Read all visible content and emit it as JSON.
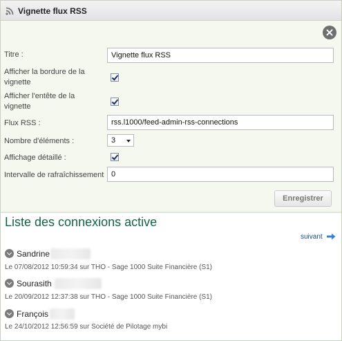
{
  "widget": {
    "title": "Vignette flux RSS",
    "icons": {
      "header": "rss-icon",
      "close": "close-circle-icon"
    }
  },
  "form": {
    "title_label": "Titre :",
    "title_value": "Vignette flux RSS",
    "border_label_1": "Afficher la bordure de la",
    "border_label_2": "vignette",
    "border_checked": true,
    "header_label_1": "Afficher l'entête de la",
    "header_label_2": "vignette",
    "header_checked": true,
    "feed_label": "Flux RSS :",
    "feed_value": "rss.l1000/feed-admin-rss-connections",
    "count_label": "Nombre d'éléments :",
    "count_value": "3",
    "detailed_label": "Affichage détaillé :",
    "detailed_checked": true,
    "refresh_label": "Intervalle de rafraîchissement",
    "refresh_value": "0",
    "save_label": "Enregistrer"
  },
  "connections": {
    "title": "Liste des connexions active",
    "next_label": "suivant",
    "items": [
      {
        "name": "Sandrine",
        "detail": "Le 07/08/2012 10:59:34 sur THO - Sage 1000 Suite Financière (S1)"
      },
      {
        "name": "Sourasith",
        "detail": "Le 20/09/2012 12:37:38 sur THO - Sage 1000 Suite Financière (S1)"
      },
      {
        "name": "François",
        "detail": "Le 24/10/2012 12:56:59 sur Société de Pilotage mybi"
      }
    ]
  }
}
